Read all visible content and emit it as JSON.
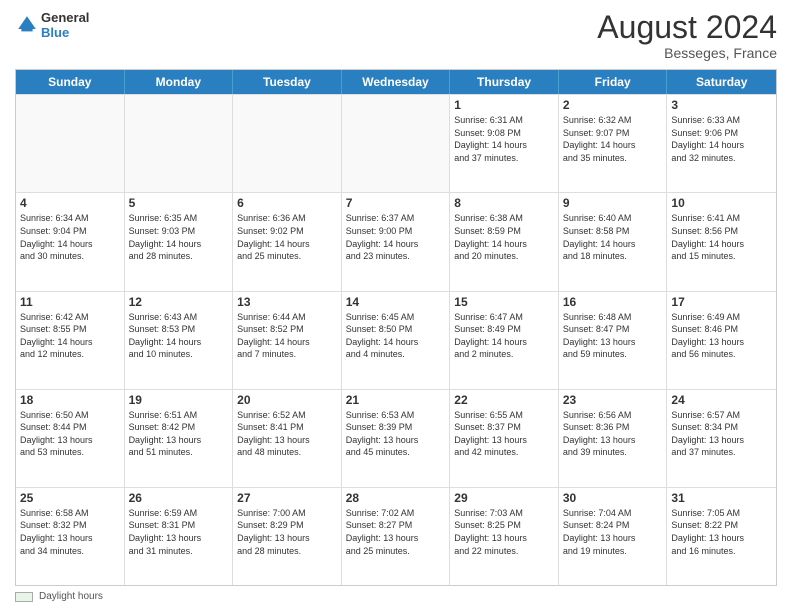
{
  "brand": {
    "line1": "General",
    "line2": "Blue"
  },
  "title": "August 2024",
  "subtitle": "Besseges, France",
  "header": {
    "days": [
      "Sunday",
      "Monday",
      "Tuesday",
      "Wednesday",
      "Thursday",
      "Friday",
      "Saturday"
    ]
  },
  "footer": {
    "label": "Daylight hours"
  },
  "weeks": [
    {
      "cells": [
        {
          "day": "",
          "info": ""
        },
        {
          "day": "",
          "info": ""
        },
        {
          "day": "",
          "info": ""
        },
        {
          "day": "",
          "info": ""
        },
        {
          "day": "1",
          "info": "Sunrise: 6:31 AM\nSunset: 9:08 PM\nDaylight: 14 hours\nand 37 minutes."
        },
        {
          "day": "2",
          "info": "Sunrise: 6:32 AM\nSunset: 9:07 PM\nDaylight: 14 hours\nand 35 minutes."
        },
        {
          "day": "3",
          "info": "Sunrise: 6:33 AM\nSunset: 9:06 PM\nDaylight: 14 hours\nand 32 minutes."
        }
      ]
    },
    {
      "cells": [
        {
          "day": "4",
          "info": "Sunrise: 6:34 AM\nSunset: 9:04 PM\nDaylight: 14 hours\nand 30 minutes."
        },
        {
          "day": "5",
          "info": "Sunrise: 6:35 AM\nSunset: 9:03 PM\nDaylight: 14 hours\nand 28 minutes."
        },
        {
          "day": "6",
          "info": "Sunrise: 6:36 AM\nSunset: 9:02 PM\nDaylight: 14 hours\nand 25 minutes."
        },
        {
          "day": "7",
          "info": "Sunrise: 6:37 AM\nSunset: 9:00 PM\nDaylight: 14 hours\nand 23 minutes."
        },
        {
          "day": "8",
          "info": "Sunrise: 6:38 AM\nSunset: 8:59 PM\nDaylight: 14 hours\nand 20 minutes."
        },
        {
          "day": "9",
          "info": "Sunrise: 6:40 AM\nSunset: 8:58 PM\nDaylight: 14 hours\nand 18 minutes."
        },
        {
          "day": "10",
          "info": "Sunrise: 6:41 AM\nSunset: 8:56 PM\nDaylight: 14 hours\nand 15 minutes."
        }
      ]
    },
    {
      "cells": [
        {
          "day": "11",
          "info": "Sunrise: 6:42 AM\nSunset: 8:55 PM\nDaylight: 14 hours\nand 12 minutes."
        },
        {
          "day": "12",
          "info": "Sunrise: 6:43 AM\nSunset: 8:53 PM\nDaylight: 14 hours\nand 10 minutes."
        },
        {
          "day": "13",
          "info": "Sunrise: 6:44 AM\nSunset: 8:52 PM\nDaylight: 14 hours\nand 7 minutes."
        },
        {
          "day": "14",
          "info": "Sunrise: 6:45 AM\nSunset: 8:50 PM\nDaylight: 14 hours\nand 4 minutes."
        },
        {
          "day": "15",
          "info": "Sunrise: 6:47 AM\nSunset: 8:49 PM\nDaylight: 14 hours\nand 2 minutes."
        },
        {
          "day": "16",
          "info": "Sunrise: 6:48 AM\nSunset: 8:47 PM\nDaylight: 13 hours\nand 59 minutes."
        },
        {
          "day": "17",
          "info": "Sunrise: 6:49 AM\nSunset: 8:46 PM\nDaylight: 13 hours\nand 56 minutes."
        }
      ]
    },
    {
      "cells": [
        {
          "day": "18",
          "info": "Sunrise: 6:50 AM\nSunset: 8:44 PM\nDaylight: 13 hours\nand 53 minutes."
        },
        {
          "day": "19",
          "info": "Sunrise: 6:51 AM\nSunset: 8:42 PM\nDaylight: 13 hours\nand 51 minutes."
        },
        {
          "day": "20",
          "info": "Sunrise: 6:52 AM\nSunset: 8:41 PM\nDaylight: 13 hours\nand 48 minutes."
        },
        {
          "day": "21",
          "info": "Sunrise: 6:53 AM\nSunset: 8:39 PM\nDaylight: 13 hours\nand 45 minutes."
        },
        {
          "day": "22",
          "info": "Sunrise: 6:55 AM\nSunset: 8:37 PM\nDaylight: 13 hours\nand 42 minutes."
        },
        {
          "day": "23",
          "info": "Sunrise: 6:56 AM\nSunset: 8:36 PM\nDaylight: 13 hours\nand 39 minutes."
        },
        {
          "day": "24",
          "info": "Sunrise: 6:57 AM\nSunset: 8:34 PM\nDaylight: 13 hours\nand 37 minutes."
        }
      ]
    },
    {
      "cells": [
        {
          "day": "25",
          "info": "Sunrise: 6:58 AM\nSunset: 8:32 PM\nDaylight: 13 hours\nand 34 minutes."
        },
        {
          "day": "26",
          "info": "Sunrise: 6:59 AM\nSunset: 8:31 PM\nDaylight: 13 hours\nand 31 minutes."
        },
        {
          "day": "27",
          "info": "Sunrise: 7:00 AM\nSunset: 8:29 PM\nDaylight: 13 hours\nand 28 minutes."
        },
        {
          "day": "28",
          "info": "Sunrise: 7:02 AM\nSunset: 8:27 PM\nDaylight: 13 hours\nand 25 minutes."
        },
        {
          "day": "29",
          "info": "Sunrise: 7:03 AM\nSunset: 8:25 PM\nDaylight: 13 hours\nand 22 minutes."
        },
        {
          "day": "30",
          "info": "Sunrise: 7:04 AM\nSunset: 8:24 PM\nDaylight: 13 hours\nand 19 minutes."
        },
        {
          "day": "31",
          "info": "Sunrise: 7:05 AM\nSunset: 8:22 PM\nDaylight: 13 hours\nand 16 minutes."
        }
      ]
    }
  ]
}
